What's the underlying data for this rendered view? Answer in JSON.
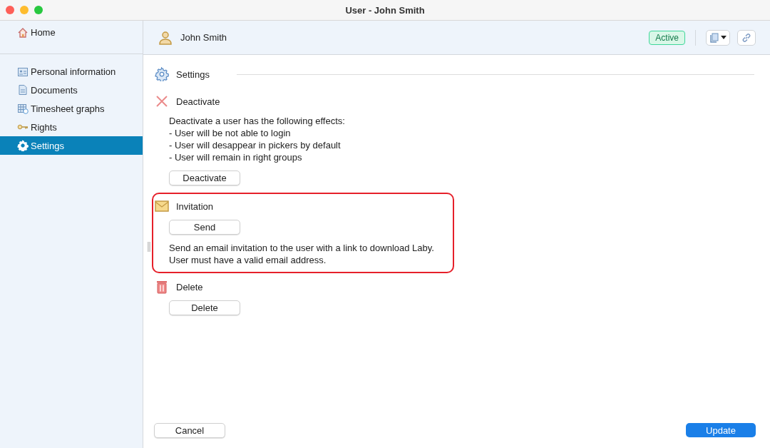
{
  "window": {
    "title": "User - John Smith"
  },
  "sidebar": {
    "home": {
      "label": "Home",
      "kind": "home"
    },
    "items": [
      {
        "label": "Personal information",
        "kind": "id",
        "selected": false
      },
      {
        "label": "Documents",
        "kind": "doc",
        "selected": false
      },
      {
        "label": "Timesheet graphs",
        "kind": "sheet",
        "selected": false
      },
      {
        "label": "Rights",
        "kind": "key",
        "selected": false
      },
      {
        "label": "Settings",
        "kind": "gear",
        "selected": true
      }
    ]
  },
  "header": {
    "name": "John Smith",
    "status": "Active"
  },
  "sections": [
    {
      "title": "Settings",
      "kind": "gear",
      "highlighted": false,
      "rule": true
    },
    {
      "title": "Deactivate",
      "kind": "cross",
      "highlighted": false,
      "rule": false,
      "blocks": [
        {
          "kind": "text",
          "lines": [
            "Deactivate a user has the following effects:",
            "- User will be not able to login",
            "- User will desappear in pickers by default",
            "- User will remain in right groups"
          ]
        },
        {
          "kind": "button",
          "label": "Deactivate"
        }
      ]
    },
    {
      "title": "Invitation",
      "kind": "mail",
      "highlighted": true,
      "rule": false,
      "blocks": [
        {
          "kind": "button",
          "label": "Send"
        },
        {
          "kind": "text",
          "lines": [
            "Send an email invitation to the user with a link to download Laby.",
            "User must have a valid email address."
          ]
        }
      ]
    },
    {
      "title": "Delete",
      "kind": "trash",
      "highlighted": false,
      "rule": false,
      "blocks": [
        {
          "kind": "button",
          "label": "Delete"
        }
      ]
    }
  ],
  "footer": {
    "cancel": "Cancel",
    "update": "Update"
  }
}
